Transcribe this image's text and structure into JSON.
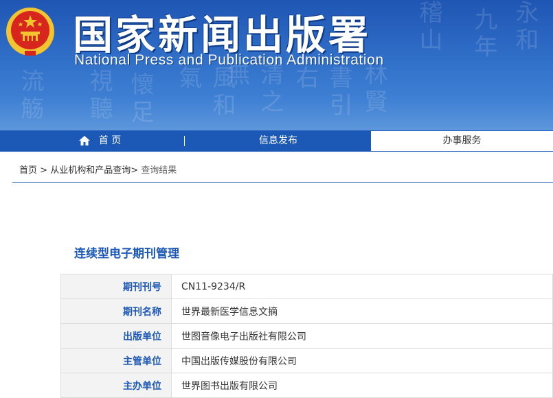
{
  "header": {
    "title_cn": "国家新闻出版署",
    "title_en": "National Press and Publication Administration",
    "emblem_icon": "national-emblem-icon"
  },
  "nav": {
    "home": "首 页",
    "info": "信息发布",
    "service": "办事服务",
    "home_icon": "home-icon"
  },
  "breadcrumb": {
    "home": "首页",
    "sep1": ">",
    "category": "从业机构和产品查询",
    "sep2": ">",
    "current": "查询结果"
  },
  "section": {
    "title": "连续型电子期刊管理"
  },
  "table": {
    "rows": [
      {
        "label": "期刊刊号",
        "value": "CN11-9234/R"
      },
      {
        "label": "期刊名称",
        "value": "世界最新医学信息文摘"
      },
      {
        "label": "出版单位",
        "value": "世图音像电子出版社有限公司"
      },
      {
        "label": "主管单位",
        "value": "中国出版传媒股份有限公司"
      },
      {
        "label": "主办单位",
        "value": "世界图书出版有限公司"
      }
    ]
  },
  "colors": {
    "brand_blue": "#1c58b5",
    "banner_blue": "#2e6cc6",
    "emblem_red": "#d7261e",
    "emblem_gold": "#f4c430"
  }
}
